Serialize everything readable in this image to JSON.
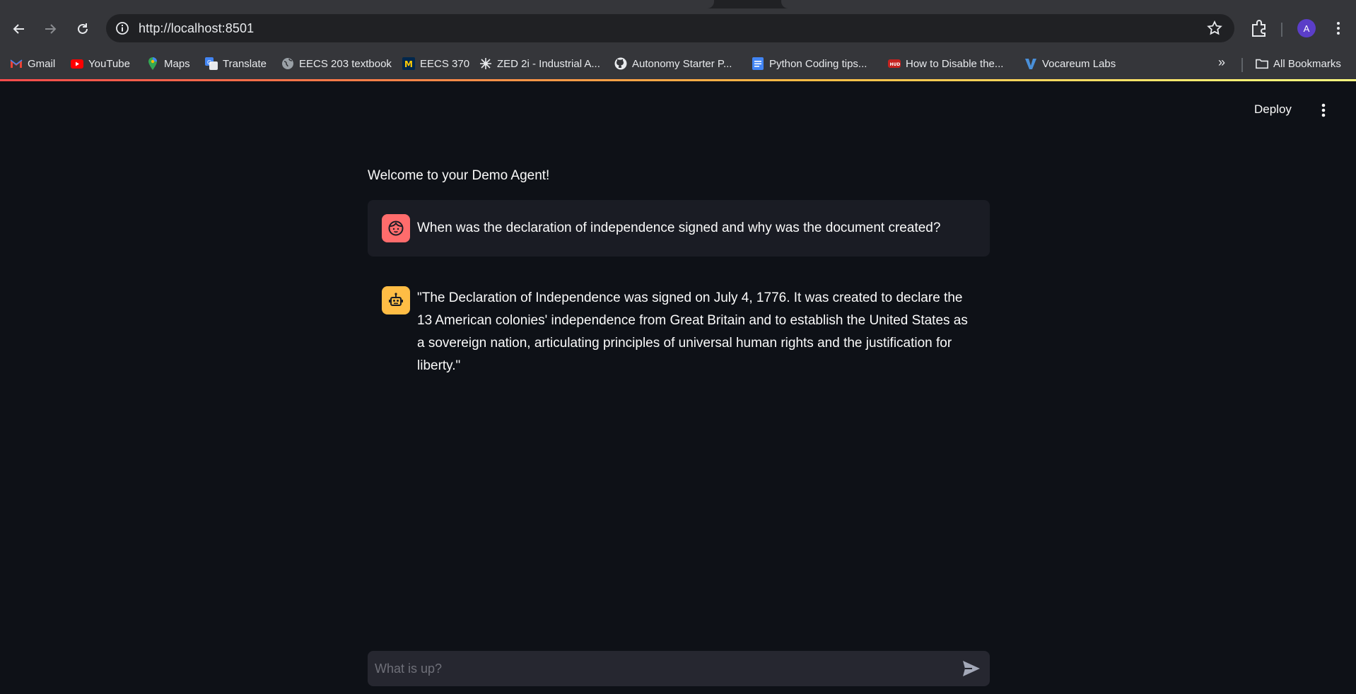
{
  "browser": {
    "url": "http://localhost:8501",
    "profile_initial": "A"
  },
  "bookmarks": [
    {
      "label": "Gmail",
      "icon": "gmail-icon"
    },
    {
      "label": "YouTube",
      "icon": "youtube-icon"
    },
    {
      "label": "Maps",
      "icon": "maps-icon"
    },
    {
      "label": "Translate",
      "icon": "translate-icon"
    },
    {
      "label": "EECS 203 textbook",
      "icon": "globe-icon"
    },
    {
      "label": "EECS 370",
      "icon": "michigan-icon"
    },
    {
      "label": "ZED 2i - Industrial A...",
      "icon": "zed-icon"
    },
    {
      "label": "Autonomy Starter P...",
      "icon": "github-icon"
    },
    {
      "label": "Python Coding tips...",
      "icon": "docs-icon"
    },
    {
      "label": "How to Disable the...",
      "icon": "hud-icon"
    },
    {
      "label": "Vocareum Labs",
      "icon": "vocareum-icon"
    }
  ],
  "all_bookmarks_label": "All Bookmarks",
  "app": {
    "deploy_label": "Deploy",
    "welcome": "Welcome to your Demo Agent!",
    "user_message": "When was the declaration of independence signed and why was the document created?",
    "assistant_message": "\"The Declaration of Independence was signed on July 4, 1776. It was created to declare the 13 American colonies' independence from Great Britain and to establish the United States as a sovereign nation, articulating principles of universal human rights and the justification for liberty.\"",
    "input_placeholder": "What is up?"
  },
  "colors": {
    "background": "#0e1117",
    "user_avatar": "#ff6c6c",
    "assistant_avatar": "#ffbd45",
    "chat_input_bg": "#262730"
  }
}
